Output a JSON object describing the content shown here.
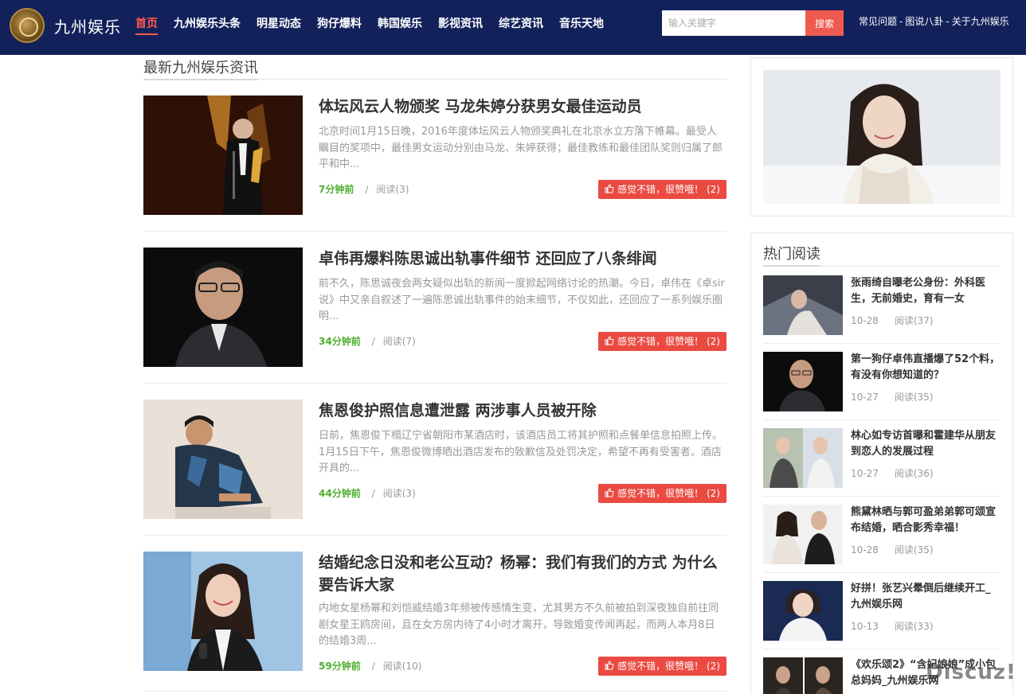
{
  "header": {
    "logo_text": "九州娱乐",
    "nav": [
      {
        "label": "首页",
        "active": true
      },
      {
        "label": "九州娱乐头条",
        "active": false
      },
      {
        "label": "明星动态",
        "active": false
      },
      {
        "label": "狗仔爆料",
        "active": false
      },
      {
        "label": "韩国娱乐",
        "active": false
      },
      {
        "label": "影视资讯",
        "active": false
      },
      {
        "label": "综艺资讯",
        "active": false
      },
      {
        "label": "音乐天地",
        "active": false
      }
    ],
    "search_placeholder": "输入关键字",
    "search_button": "搜索",
    "top_links": [
      "常见问题",
      "图说八卦",
      "关于九州娱乐"
    ],
    "top_link_separator": "-"
  },
  "main": {
    "section_title": "最新九州娱乐资讯",
    "articles": [
      {
        "title": "体坛风云人物颁奖 马龙朱婷分获男女最佳运动员",
        "excerpt": "北京时间1月15日晚，2016年度体坛风云人物颁奖典礼在北京水立方落下帷幕。最受人瞩目的奖项中，最佳男女运动分别由马龙、朱婷获得；最佳教练和最佳团队奖则归属了郎平和中...",
        "time": "7分钟前",
        "reads": "阅读(3)",
        "like": "感觉不错，很赞哦！ (2)"
      },
      {
        "title": "卓伟再爆料陈思诚出轨事件细节 还回应了八条绯闻",
        "excerpt": "前不久，陈思诚夜会两女疑似出轨的新闻一度掀起网络讨论的热潮。今日，卓伟在《卓sir说》中又亲自叙述了一遍陈思诚出轨事件的始末细节，不仅如此，还回应了一系列娱乐圈明...",
        "time": "34分钟前",
        "reads": "阅读(7)",
        "like": "感觉不错，很赞哦！ (2)"
      },
      {
        "title": "焦恩俊护照信息遭泄露 两涉事人员被开除",
        "excerpt": "日前，焦恩俊下榻辽宁省朝阳市某酒店时，该酒店员工将其护照和点餐单信息拍照上传。1月15日下午，焦恩俊微博晒出酒店发布的致歉信及处罚决定，希望不再有受害者。酒店开具的...",
        "time": "44分钟前",
        "reads": "阅读(3)",
        "like": "感觉不错，很赞哦！ (2)"
      },
      {
        "title": "结婚纪念日没和老公互动？杨幂：我们有我们的方式 为什么要告诉大家",
        "excerpt": "内地女星杨幂和刘恺威结婚3年频被传感情生变，尤其男方不久前被拍到深夜独自前往同剧女星王鸥房间，且在女方房内待了4小时才离开，导致婚变传闻再起，而两人本月8日的结婚3周...",
        "time": "59分钟前",
        "reads": "阅读(10)",
        "like": "感觉不错，很赞哦！ (2)"
      }
    ]
  },
  "sidebar": {
    "hot_title": "热门阅读",
    "hot_items": [
      {
        "title": "张雨绮自曝老公身份：外科医生，无前婚史，育有一女",
        "date": "10-28",
        "reads": "阅读(37)"
      },
      {
        "title": "第一狗仔卓伟直播爆了52个料，有没有你想知道的？",
        "date": "10-27",
        "reads": "阅读(35)"
      },
      {
        "title": "林心如专访首曝和霍建华从朋友到恋人的发展过程",
        "date": "10-27",
        "reads": "阅读(36)"
      },
      {
        "title": "熊黛林晒与郭可盈弟弟郭可颂宣布结婚，晒合影秀幸福！",
        "date": "10-28",
        "reads": "阅读(35)"
      },
      {
        "title": "好拼！张艺兴晕倒后继续开工_九州娱乐网",
        "date": "10-13",
        "reads": "阅读(33)"
      },
      {
        "title": "《欢乐颂2》“含妃娘娘”成小包总妈妈_九州娱乐网",
        "date": "",
        "reads": ""
      }
    ]
  },
  "watermark": "Discuz!"
}
